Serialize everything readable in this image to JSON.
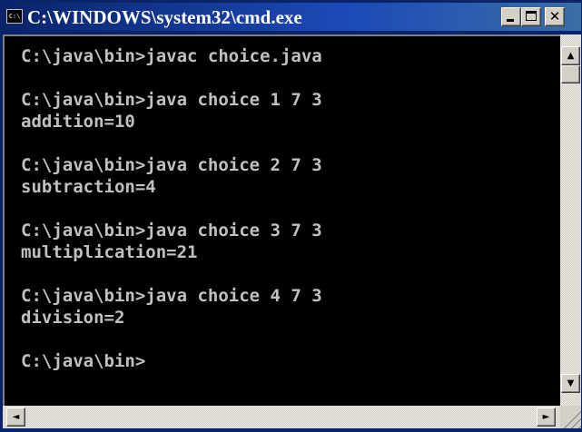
{
  "window": {
    "title": "C:\\WINDOWS\\system32\\cmd.exe",
    "icon_label": "C:\\",
    "colors": {
      "titlebar": "#0a246a",
      "console_bg": "#000000",
      "console_fg": "#c0c0c0",
      "chrome": "#d4d0c8"
    }
  },
  "caption_buttons": {
    "minimize_icon": "minimize-icon",
    "maximize_icon": "maximize-icon",
    "close_icon": "close-icon",
    "close_glyph": "✕"
  },
  "console": {
    "lines": [
      "",
      "C:\\java\\bin>javac choice.java",
      "",
      "C:\\java\\bin>java choice 1 7 3",
      "addition=10",
      "",
      "C:\\java\\bin>java choice 2 7 3",
      "subtraction=4",
      "",
      "C:\\java\\bin>java choice 3 7 3",
      "multiplication=21",
      "",
      "C:\\java\\bin>java choice 4 7 3",
      "division=2",
      "",
      "C:\\java\\bin>"
    ]
  },
  "scrollbar": {
    "up_glyph": "▲",
    "down_glyph": "▼",
    "left_glyph": "◄",
    "right_glyph": "►",
    "vertical_position": 0
  }
}
